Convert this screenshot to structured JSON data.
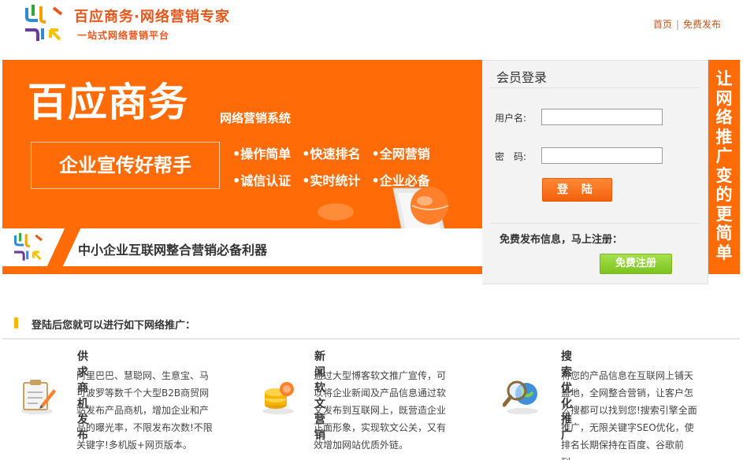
{
  "header": {
    "title": "百应商务·网络营销专家",
    "subtitle": "一站式网络营销平台",
    "nav": [
      {
        "label": "首页"
      },
      {
        "label": "免费发布"
      }
    ]
  },
  "banner": {
    "brand": "百应商务",
    "system": "网络营销系统",
    "slogan": "企业宣传好帮手",
    "features": [
      "•操作简单",
      "•快速排名",
      "•全网营销",
      "•诚信认证",
      "•实时统计",
      "•企业必备"
    ],
    "strip_text": "中小企业互联网整合营销必备利器"
  },
  "login": {
    "title": "会员登录",
    "username_label": "用户名:",
    "password_label": "密　码:",
    "username_value": "",
    "password_value": "",
    "login_button": "登 陆",
    "register_prompt": "免费发布信息，马上注册：",
    "register_button": "免费注册"
  },
  "side_banner": [
    "让",
    "网",
    "络",
    "推",
    "广",
    "变",
    "的",
    "更",
    "简",
    "单"
  ],
  "section": {
    "heading": "登陆后您就可以进行如下网络推广：",
    "columns": [
      {
        "icon": "clipboard-pen-icon",
        "title": "供求商机发布",
        "desc": "阿里巴巴、慧聪网、生意宝、马可波罗等数千个大型B2B商贸网站发布产品商机，增加企业和产品的曝光率，不限发布次数!不限关键字!多机版+网页版本。"
      },
      {
        "icon": "coin-stack-icon",
        "title": "新闻软文营销",
        "desc": "通过大型博客软文推广宣传，可以将企业新闻及产品信息通过软文发布到互联网上，既营造企业正面形象，实现软文公关，又有效增加网站优质外链。"
      },
      {
        "icon": "magnifier-globe-icon",
        "title": "搜索优化推广",
        "desc": "将您的产品信息在互联网上铺天盖地，全网整合营销，让客户怎么搜都可以找到您!搜索引擎全面推广，无限关键字SEO优化，使排名长期保持在百度、谷歌前列。"
      }
    ]
  },
  "colors": {
    "brand_orange": "#ff6b07",
    "title_orange": "#e8561a",
    "register_green": "#7cc31f"
  }
}
